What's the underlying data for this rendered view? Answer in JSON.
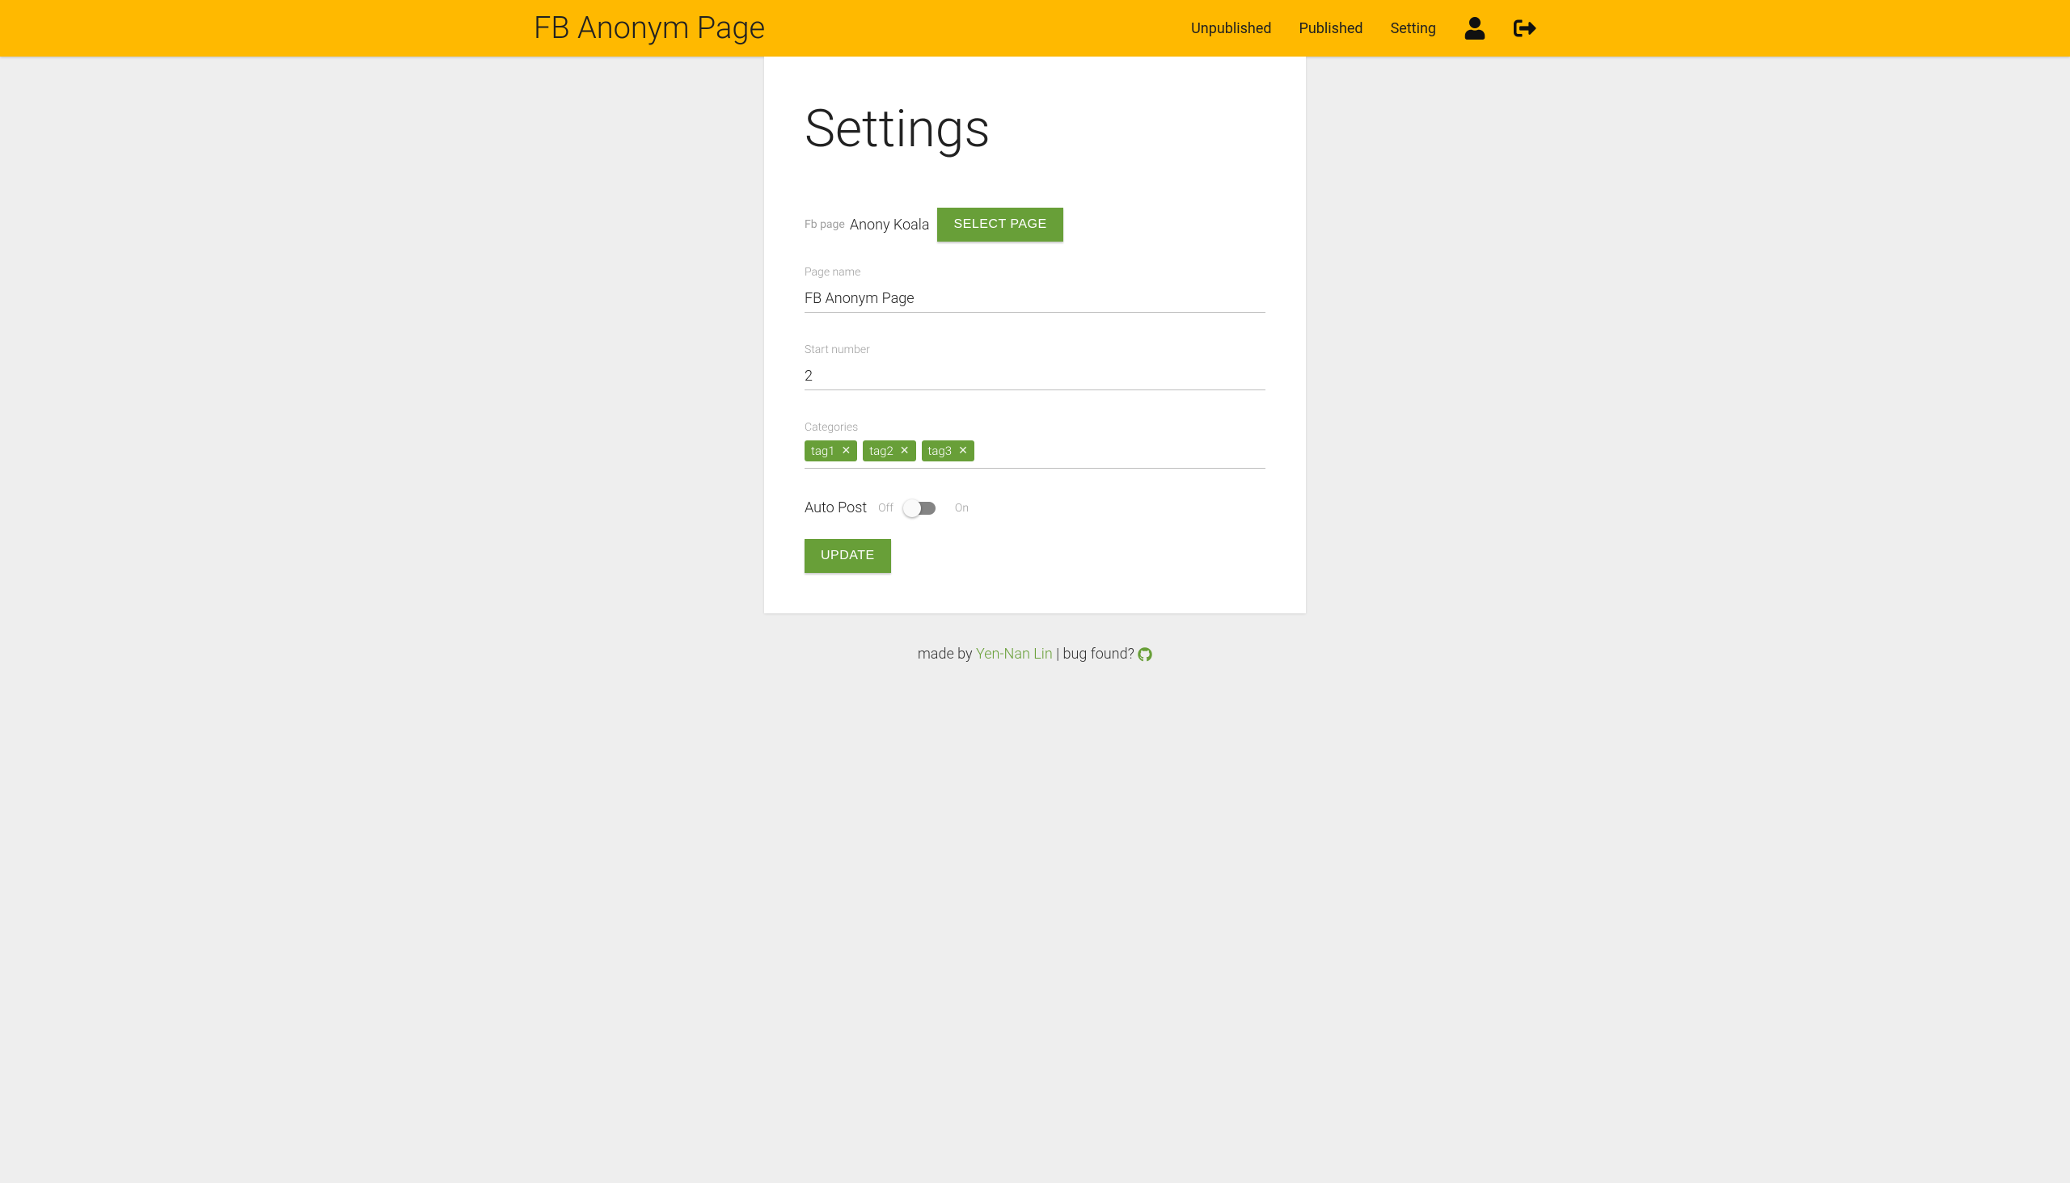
{
  "header": {
    "brand": "FB Anonym Page",
    "nav": {
      "unpublished": "Unpublished",
      "published": "Published",
      "setting": "Setting"
    }
  },
  "page": {
    "title": "Settings"
  },
  "form": {
    "fb_page_label": "Fb page",
    "fb_page_value": "Anony Koala",
    "select_page_btn": "Select Page",
    "page_name_label": "Page name",
    "page_name_value": "FB Anonym Page",
    "start_number_label": "Start number",
    "start_number_value": "2",
    "categories_label": "Categories",
    "categories": [
      {
        "label": "tag1"
      },
      {
        "label": "tag2"
      },
      {
        "label": "tag3"
      }
    ],
    "auto_post_label": "Auto Post",
    "auto_post_off": "Off",
    "auto_post_on": "On",
    "update_btn": "Update"
  },
  "footer": {
    "prefix": "made by ",
    "author": "Yen-Nan Lin",
    "suffix": " | bug found? "
  }
}
